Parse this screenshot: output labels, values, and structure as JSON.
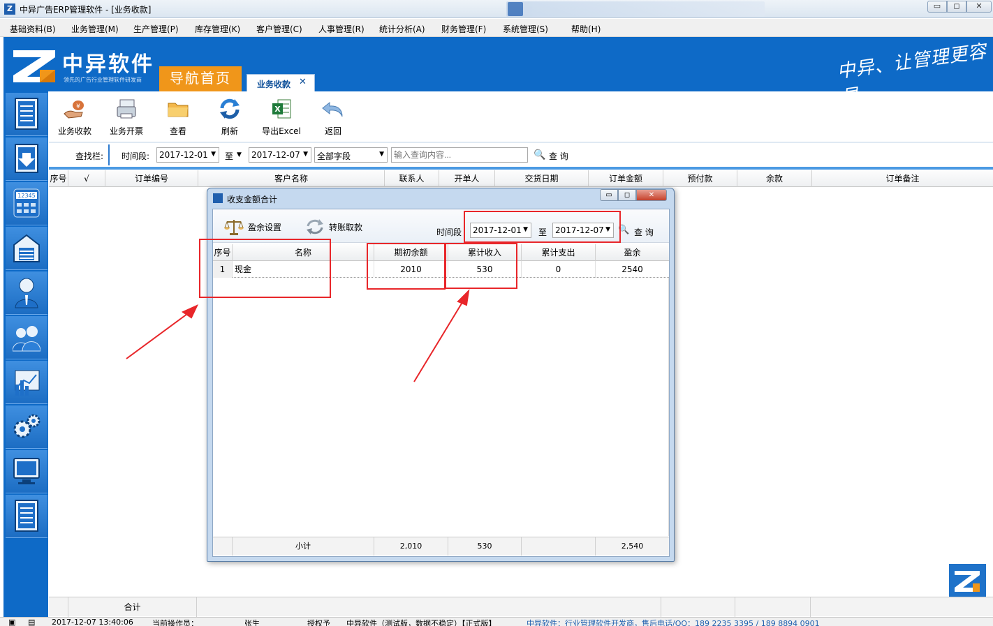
{
  "window": {
    "title": "中异广告ERP管理软件 - [业务收款]",
    "min_glyph": "▭",
    "max_glyph": "◻",
    "close_glyph": "✕"
  },
  "menu": [
    "基础资料(B)",
    "业务管理(M)",
    "生产管理(P)",
    "库存管理(K)",
    "客户管理(C)",
    "人事管理(R)",
    "统计分析(A)",
    "财务管理(F)",
    "系统管理(S)",
    "帮助(H)"
  ],
  "header": {
    "brand": "中异软件",
    "brand_sub": "领先的广告行业管理软件研发商",
    "nav_home": "导航首页",
    "active_tab": "业务收款",
    "tab_close": "✕",
    "slogan": "中异、让管理更容易",
    "brand_color": "#0e6ac7",
    "accent_color": "#f0961a"
  },
  "sidebar_icons": [
    "document-icon",
    "download-icon",
    "calculator-icon",
    "warehouse-icon",
    "user-icon",
    "users-icon",
    "chart-icon",
    "gears-icon",
    "monitor-icon",
    "list-icon"
  ],
  "toolbar": [
    {
      "label": "业务收款",
      "icon": "payment-icon"
    },
    {
      "label": "业务开票",
      "icon": "invoice-icon"
    },
    {
      "label": "查看",
      "icon": "folder-icon"
    },
    {
      "label": "刷新",
      "icon": "refresh-icon"
    },
    {
      "label": "导出Excel",
      "icon": "excel-icon"
    },
    {
      "label": "返回",
      "icon": "back-icon"
    }
  ],
  "search": {
    "label": "查找栏:",
    "period_label": "时间段:",
    "date_from": "2017-12-01",
    "to_label": "至",
    "date_to": "2017-12-07",
    "field": "全部字段",
    "placeholder": "输入查询内容...",
    "query_label": "查 询"
  },
  "main_grid": {
    "columns": [
      "序号",
      "√",
      "订单编号",
      "客户名称",
      "联系人",
      "开单人",
      "交货日期",
      "订单金额",
      "预付款",
      "余款",
      "订单备注"
    ],
    "footer_label": "合计"
  },
  "status": {
    "datetime": "2017-12-07 13:40:06",
    "operator_label": "当前操作员：",
    "operator": "张生",
    "license_label": "授权予",
    "edition": "中异软件（测试版，数据不稳定）【正式版】",
    "contact": "中异软件：行业管理软件开发商，售后电话/QQ：189 2235 3395 / 189 8894 0901"
  },
  "dialog": {
    "title": "收支金额合计",
    "tools": [
      {
        "label": "盈余设置",
        "icon": "balance-scale-icon"
      },
      {
        "label": "转账取款",
        "icon": "transfer-icon"
      }
    ],
    "period_label": "时间段",
    "date_from": "2017-12-01",
    "to_label": "至",
    "date_to": "2017-12-07",
    "query_label": "查 询",
    "columns": [
      "序号",
      "名称",
      "期初余额",
      "累计收入",
      "累计支出",
      "盈余"
    ],
    "rows": [
      {
        "index": "1",
        "name": "现金",
        "opening": "2010",
        "income": "530",
        "expense": "0",
        "surplus": "2540"
      }
    ],
    "footer": {
      "label": "小计",
      "opening": "2,010",
      "income": "530",
      "expense": "",
      "surplus": "2,540"
    }
  }
}
